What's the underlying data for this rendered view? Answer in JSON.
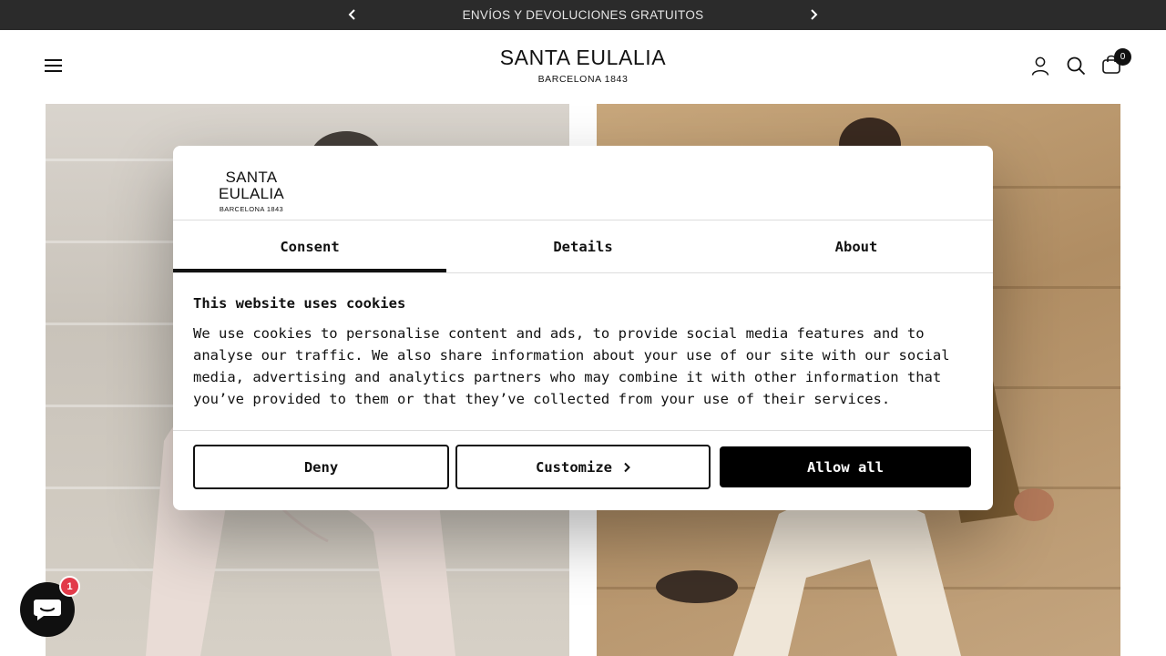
{
  "announcement": {
    "text": "ENVÍOS Y DEVOLUCIONES GRATUITOS",
    "prev_icon": "chevron-left-icon",
    "next_icon": "chevron-right-icon"
  },
  "header": {
    "logo_main": "SANTA EULALIA",
    "logo_sub": "BARCELONA 1843",
    "menu_icon": "hamburger-menu-icon",
    "account_icon": "user-icon",
    "search_icon": "search-icon",
    "cart_icon": "shopping-bag-icon",
    "cart_count": "0"
  },
  "cookie_dialog": {
    "logo_main": "SANTA EULALIA",
    "logo_sub": "BARCELONA 1843",
    "tabs": [
      {
        "label": "Consent",
        "active": true
      },
      {
        "label": "Details",
        "active": false
      },
      {
        "label": "About",
        "active": false
      }
    ],
    "heading": "This website uses cookies",
    "body_lines": [
      "We use cookies to personalise content and ads, to provide social media features and to",
      "analyse our traffic. We also share information about your use of our site with our social",
      "media, advertising and analytics partners who may combine it with other information that",
      "you’ve provided to them or that they’ve collected from your use of their services."
    ],
    "buttons": {
      "deny": "Deny",
      "customize": "Customize",
      "allow_all": "Allow all"
    }
  },
  "chat": {
    "icon": "chat-bubble-icon",
    "badge_count": "1",
    "badge_color": "#e23b4a"
  },
  "colors": {
    "announcement_bg": "#2b2b2b",
    "primary": "#111111",
    "allow_button_bg": "#000000"
  }
}
